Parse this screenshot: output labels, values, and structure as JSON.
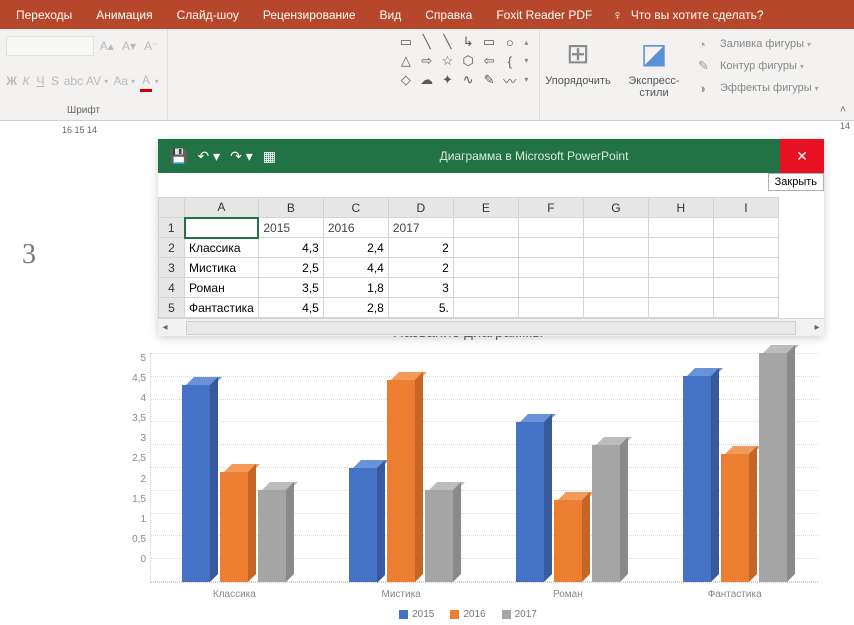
{
  "ribbon": {
    "tabs": [
      "Переходы",
      "Анимация",
      "Слайд-шоу",
      "Рецензирование",
      "Вид",
      "Справка",
      "Foxit Reader PDF"
    ],
    "tell_me": "Что вы хотите сделать?",
    "font_group_label": "Шрифт",
    "arrange_label": "Упорядочить",
    "express_styles_label": "Экспресс-\nстили",
    "fill": {
      "shape_fill": "Заливка фигуры",
      "shape_outline": "Контур фигуры",
      "shape_effects": "Эффекты фигуры"
    }
  },
  "ruler": {
    "left": "16  15  14",
    "right": "14"
  },
  "slide_number": "3",
  "excel": {
    "title": "Диаграмма в Microsoft PowerPoint",
    "close_tooltip": "Закрыть",
    "cols": [
      "A",
      "B",
      "C",
      "D",
      "E",
      "F",
      "G",
      "H",
      "I"
    ],
    "rows": [
      "1",
      "2",
      "3",
      "4",
      "5"
    ],
    "headers": [
      "",
      "2015",
      "2016",
      "2017"
    ],
    "data": [
      [
        "Классика",
        "4,3",
        "2,4",
        "2"
      ],
      [
        "Мистика",
        "2,5",
        "4,4",
        "2"
      ],
      [
        "Роман",
        "3,5",
        "1,8",
        "3"
      ],
      [
        "Фантастика",
        "4,5",
        "2,8",
        "5."
      ]
    ]
  },
  "chart_data": {
    "type": "bar",
    "title": "Название диаграммы",
    "categories": [
      "Классика",
      "Мистика",
      "Роман",
      "Фантастика"
    ],
    "series": [
      {
        "name": "2015",
        "values": [
          4.3,
          2.5,
          3.5,
          4.5
        ]
      },
      {
        "name": "2016",
        "values": [
          2.4,
          4.4,
          1.8,
          2.8
        ]
      },
      {
        "name": "2017",
        "values": [
          2.0,
          2.0,
          3.0,
          5.0
        ]
      }
    ],
    "ylabel": "",
    "xlabel": "",
    "ylim": [
      0,
      5
    ],
    "y_ticks": [
      "0",
      "0,5",
      "1",
      "1,5",
      "2",
      "2,5",
      "3",
      "3,5",
      "4",
      "4,5",
      "5"
    ]
  }
}
